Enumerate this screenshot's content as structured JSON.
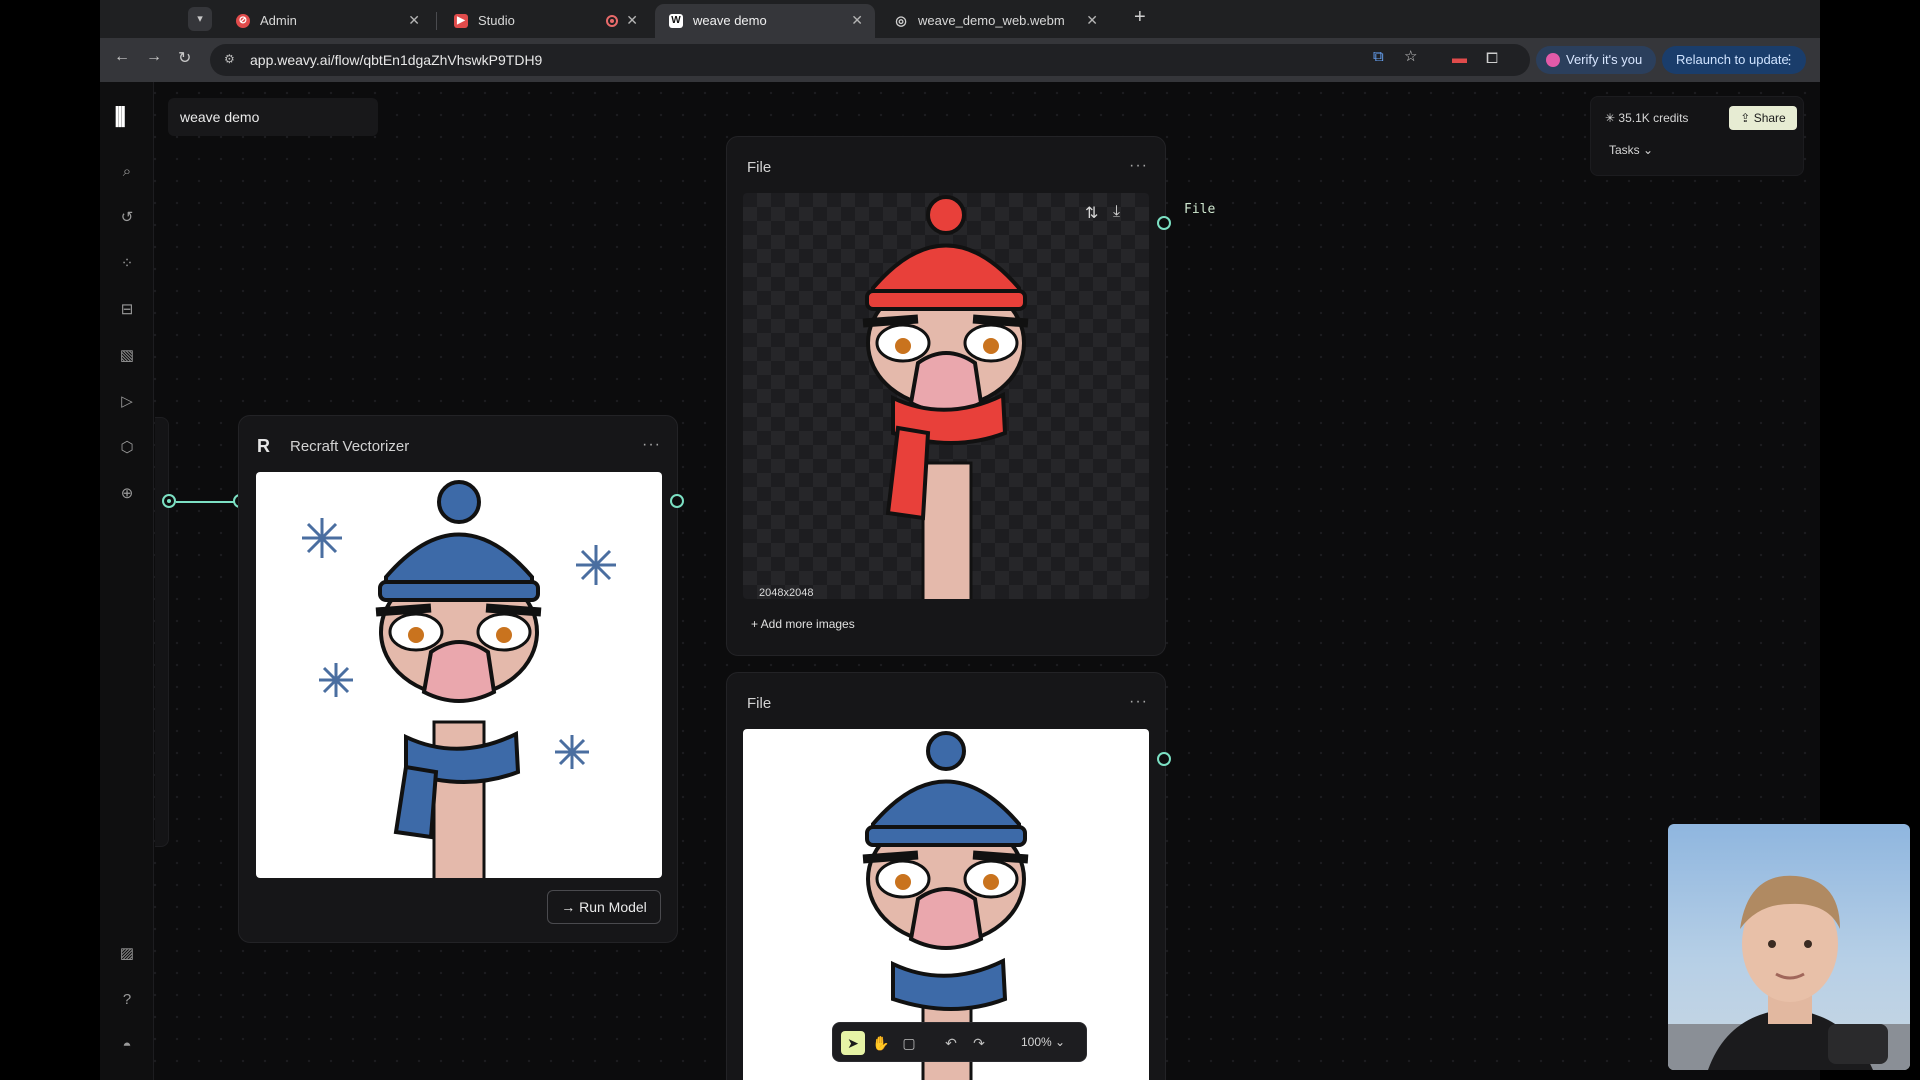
{
  "browser": {
    "tabs": [
      {
        "title": "Admin",
        "favicon": "admin-favicon",
        "active": false
      },
      {
        "title": "Studio",
        "favicon": "studio-favicon",
        "active": false,
        "recording": true
      },
      {
        "title": "weave demo",
        "favicon": "weavy-favicon",
        "active": true
      },
      {
        "title": "weave_demo_web.webm",
        "favicon": "globe-favicon",
        "active": false
      }
    ],
    "url": "app.weavy.ai/flow/qbtEn1dgaZhVhswkP9TDH9",
    "verify_label": "Verify it's you",
    "relaunch_label": "Relaunch to update"
  },
  "app": {
    "project_name": "weave demo",
    "credits": "35.1K credits",
    "share_label": "Share",
    "tasks_label": "Tasks",
    "sidebar_icons": [
      "search-icon",
      "history-icon",
      "apps-icon",
      "toolbox-icon",
      "image-icon",
      "video-icon",
      "3d-box-icon",
      "globe-icon",
      "gallery-icon",
      "help-icon",
      "discord-icon"
    ]
  },
  "nodes": {
    "vectorizer": {
      "title": "Recraft Vectorizer",
      "menu": "···",
      "run_label": "Run Model"
    },
    "file_top": {
      "title": "File",
      "menu": "···",
      "resolution": "2048x2048",
      "add_more": "+ Add more images",
      "output_label": "File"
    },
    "file_bottom": {
      "title": "File",
      "menu": "···"
    }
  },
  "canvas_toolbar": {
    "zoom": "100%"
  },
  "colors": {
    "accent": "#7ce0c3",
    "share_bg": "#e7ecd3",
    "select_tool_bg": "#e6f3a6",
    "hat_red": "#e8403a",
    "hat_blue": "#3d6aa8",
    "snowflake": "#4a6ea0"
  }
}
